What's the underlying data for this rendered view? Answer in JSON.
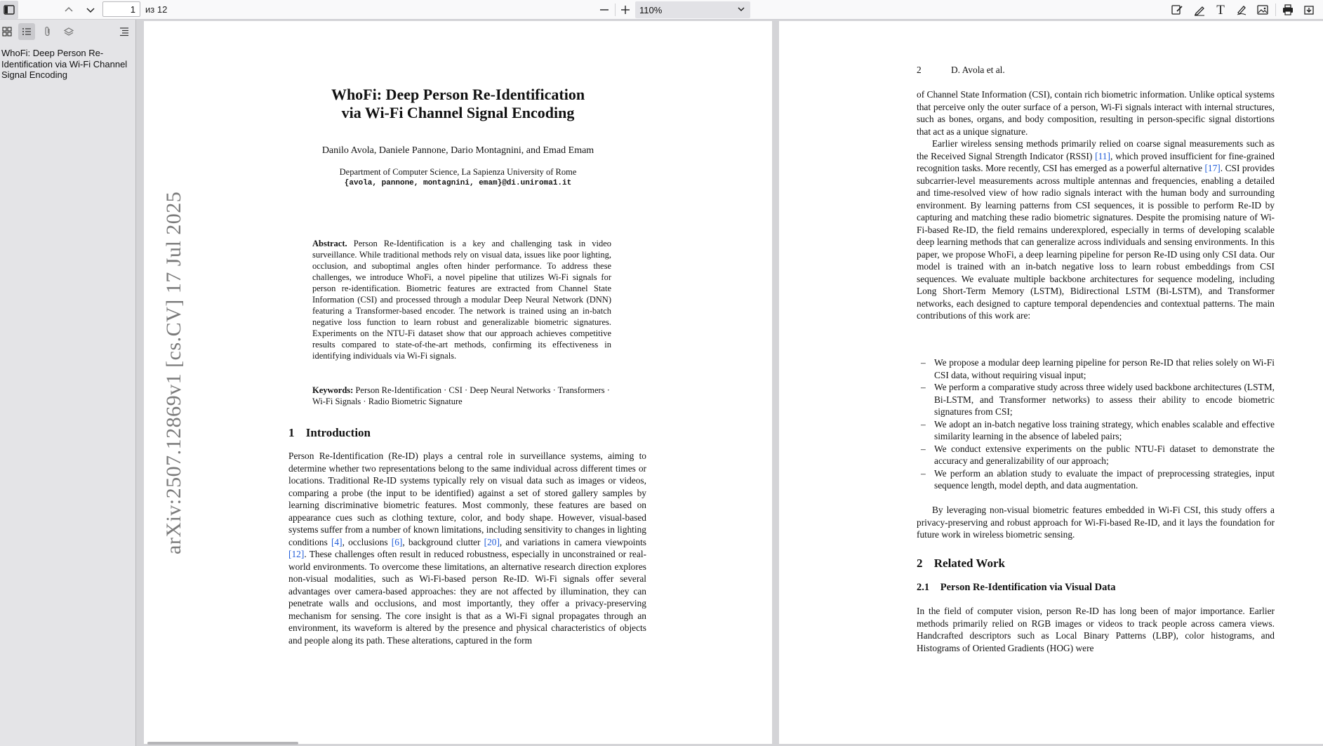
{
  "toolbar": {
    "page_number": "1",
    "page_count": "из 12",
    "zoom": "110%"
  },
  "sidebar": {
    "outline": [
      {
        "label": "WhoFi: Deep Person Re-Identification via Wi-Fi Channel Signal Encoding"
      }
    ]
  },
  "page1": {
    "title_line1": "WhoFi: Deep Person Re-Identification",
    "title_line2": "via Wi-Fi Channel Signal Encoding",
    "authors": "Danilo Avola, Daniele Pannone, Dario Montagnini, and Emad Emam",
    "affiliation": "Department of Computer Science, La Sapienza University of Rome",
    "email": "{avola, pannone, montagnini, emam}@di.uniroma1.it",
    "arxiv_stamp": "arXiv:2507.12869v1  [cs.CV]  17 Jul 2025",
    "abstract_label": "Abstract.",
    "abstract_text": "Person Re-Identification is a key and challenging task in video surveillance. While traditional methods rely on visual data, issues like poor lighting, occlusion, and suboptimal angles often hinder performance. To address these challenges, we introduce WhoFi, a novel pipeline that utilizes Wi-Fi signals for person re-identification. Biometric features are extracted from Channel State Information (CSI) and processed through a modular Deep Neural Network (DNN) featuring a Transformer-based encoder. The network is trained using an in-batch negative loss function to learn robust and generalizable biometric signatures. Experiments on the NTU-Fi dataset show that our approach achieves competitive results compared to state-of-the-art methods, confirming its effectiveness in identifying individuals via Wi-Fi signals.",
    "keywords_label": "Keywords:",
    "keywords_text": "Person Re-Identification · CSI · Deep Neural Networks · Transformers · Wi-Fi Signals · Radio Biometric Signature",
    "section1_number": "1",
    "section1_title": "Introduction",
    "intro_p1": "Person Re-Identification (Re-ID) plays a central role in surveillance systems, aiming to determine whether two representations belong to the same individual across different times or locations. Traditional Re-ID systems typically rely on visual data such as images or videos, comparing a probe (the input to be identified) against a set of stored gallery samples by learning discriminative biometric features. Most commonly, these features are based on appearance cues such as clothing texture, color, and body shape. However, visual-based systems suffer from a number of known limitations, including sensitivity to changes in lighting conditions ",
    "ref4": "[4]",
    "intro_p2": ", occlusions ",
    "ref6": "[6]",
    "intro_p3": ", background clutter ",
    "ref20": "[20]",
    "intro_p4": ", and variations in camera viewpoints ",
    "ref12": "[12]",
    "intro_p5": ". These challenges often result in reduced robustness, especially in unconstrained or real-world environments. To overcome these limitations, an alternative research direction explores non-visual modalities, such as Wi-Fi-based person Re-ID. Wi-Fi signals offer several advantages over camera-based approaches: they are not affected by illumination, they can penetrate walls and occlusions, and most importantly, they offer a privacy-preserving mechanism for sensing. The core insight is that as a Wi-Fi signal propagates through an environment, its waveform is altered by the presence and physical characteristics of objects and people along its path. These alterations, captured in the form"
  },
  "page2": {
    "page_number": "2",
    "running_head": "D. Avola et al.",
    "para1": "of Channel State Information (CSI), contain rich biometric information. Unlike optical systems that perceive only the outer surface of a person, Wi-Fi signals interact with internal structures, such as bones, organs, and body composition, resulting in person-specific signal distortions that act as a unique signature.",
    "para2_a": "Earlier wireless sensing methods primarily relied on coarse signal measurements such as the Received Signal Strength Indicator (RSSI) ",
    "ref11": "[11]",
    "para2_b": ", which proved insufficient for fine-grained recognition tasks. More recently, CSI has emerged as a powerful alternative ",
    "ref17": "[17]",
    "para2_c": ". CSI provides subcarrier-level measurements across multiple antennas and frequencies, enabling a detailed and time-resolved view of how radio signals interact with the human body and surrounding environment. By learning patterns from CSI sequences, it is possible to perform Re-ID by capturing and matching these radio biometric signatures. Despite the promising nature of Wi-Fi-based Re-ID, the field remains underexplored, especially in terms of developing scalable deep learning methods that can generalize across individuals and sensing environments. In this paper, we propose WhoFi, a deep learning pipeline for person Re-ID using only CSI data. Our model is trained with an in-batch negative loss to learn robust embeddings from CSI sequences. We evaluate multiple backbone architectures for sequence modeling, including Long Short-Term Memory (LSTM), Bidirectional LSTM (Bi-LSTM), and Transformer networks, each designed to capture temporal dependencies and contextual patterns. The main contributions of this work are:",
    "contributions": [
      "We propose a modular deep learning pipeline for person Re-ID that relies solely on Wi-Fi CSI data, without requiring visual input;",
      "We perform a comparative study across three widely used backbone architectures (LSTM, Bi-LSTM, and Transformer networks) to assess their ability to encode biometric signatures from CSI;",
      "We adopt an in-batch negative loss training strategy, which enables scalable and effective similarity learning in the absence of labeled pairs;",
      "We conduct extensive experiments on the public NTU-Fi dataset to demonstrate the accuracy and generalizability of our approach;",
      "We perform an ablation study to evaluate the impact of preprocessing strategies, input sequence length, model depth, and data augmentation."
    ],
    "para3": "By leveraging non-visual biometric features embedded in Wi-Fi CSI, this study offers a privacy-preserving and robust approach for Wi-Fi-based Re-ID, and it lays the foundation for future work in wireless biometric sensing.",
    "section2_number": "2",
    "section2_title": "Related Work",
    "section21_number": "2.1",
    "section21_title": "Person Re-Identification via Visual Data",
    "para4": "In the field of computer vision, person Re-ID has long been of major importance. Earlier methods primarily relied on RGB images or videos to track people across camera views. Handcrafted descriptors such as Local Binary Patterns (LBP), color histograms, and Histograms of Oriented Gradients (HOG) were"
  }
}
